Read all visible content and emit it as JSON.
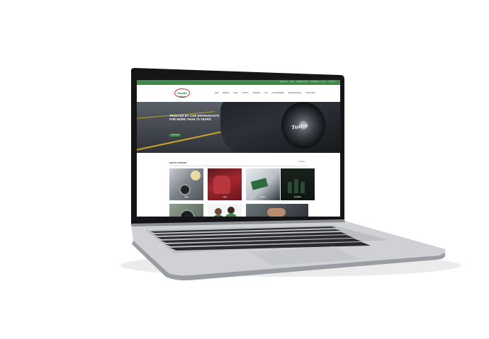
{
  "topbar": {
    "links": [
      "ABOUT US",
      "FAQ",
      "WHERE TO BUY",
      "RETAILER",
      "BLOG",
      "CONTACT"
    ]
  },
  "header": {
    "logo_text": "Turtle Wax",
    "nav": [
      "NEW",
      "BRAND",
      "CARS",
      "POLISH",
      "CERAMIC",
      "ICE",
      "ACCESSORIES",
      "PROFESSIONAL",
      "SHOP NOW"
    ]
  },
  "hero": {
    "headline": "TRUSTED BY CAR ENTHUSIASTS FOR MORE THAN 75 YEARS",
    "cta": "SHOP NOW",
    "brand": "Turtle"
  },
  "categories": {
    "title": "SHOP BY CATEGORY",
    "view_all": "VIEW ALL",
    "tiles": [
      "WASH",
      "CARE",
      "DETAIL",
      "EXTERIOR",
      "",
      "",
      ""
    ]
  },
  "colors": {
    "brand_green": "#3f8a4a",
    "accent_red": "#c92b2b"
  }
}
